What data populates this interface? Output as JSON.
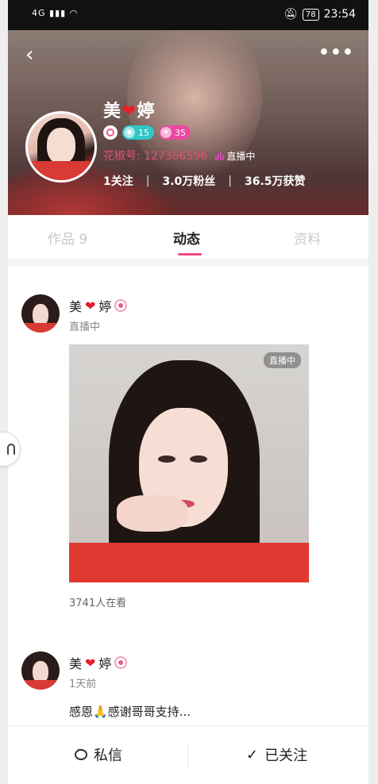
{
  "status_bar": {
    "signal": "4G",
    "battery": "78",
    "time": "23:54"
  },
  "header": {
    "back_icon": "back-arrow-icon",
    "more_icon": "more-dots-icon",
    "name_part1": "美",
    "heart": "❤",
    "name_part2": "婷",
    "badges": {
      "diamond_level": "15",
      "star_level": "35"
    },
    "user_id": "花椒号: 127366596",
    "live_status": "直播中",
    "stats": {
      "following": "1关注",
      "fans": "3.0万粉丝",
      "likes": "36.5万获赞"
    }
  },
  "tabs": [
    {
      "label": "作品 9",
      "active": false
    },
    {
      "label": "动态",
      "active": true
    },
    {
      "label": "资料",
      "active": false
    }
  ],
  "posts": [
    {
      "name_part1": "美",
      "heart": "❤",
      "name_part2": "婷",
      "sub": "直播中",
      "live_badge": "直播中",
      "viewers": "3741人在看"
    },
    {
      "name_part1": "美",
      "heart": "❤",
      "name_part2": "婷",
      "sub": "1天前",
      "text": "感恩🙏感谢哥哥支持..."
    }
  ],
  "bottom_bar": {
    "message_label": "私信",
    "follow_label": "已关注",
    "follow_check": "✓"
  },
  "colors": {
    "accent": "#ee4c7c",
    "heart": "#e3202b"
  }
}
